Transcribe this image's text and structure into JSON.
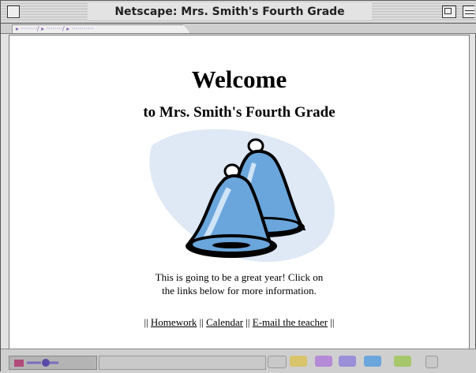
{
  "window": {
    "title": "Netscape: Mrs. Smith's Fourth Grade"
  },
  "page": {
    "heading": "Welcome",
    "subheading": "to Mrs. Smith's Fourth Grade",
    "intro_line1": "This is going to be a great year! Click on",
    "intro_line2": "the links below for more information.",
    "links": {
      "sep": "||",
      "homework": "Homework",
      "calendar": "Calendar",
      "email": "E-mail the teacher"
    },
    "image_icon": "bells-icon"
  },
  "colors": {
    "bell_blue": "#6aa6dc",
    "backdrop_blue": "#dfe8f5",
    "link": "#000000"
  }
}
